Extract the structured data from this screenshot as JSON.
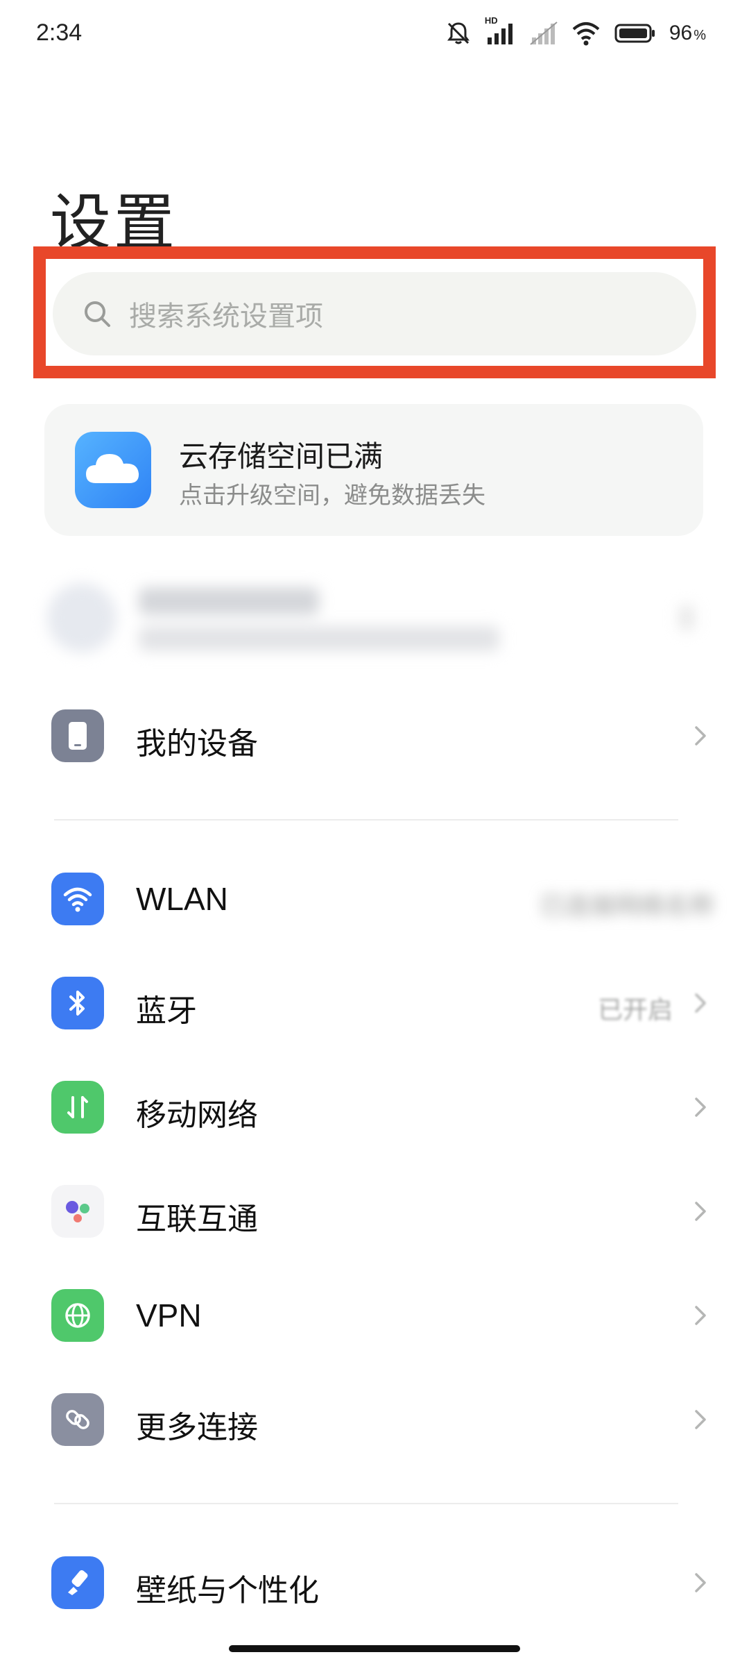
{
  "status_bar": {
    "time": "2:34",
    "network_badge": "HD",
    "battery_percent": "96",
    "battery_unit": "%"
  },
  "page": {
    "title": "设置"
  },
  "search": {
    "placeholder": "搜索系统设置项",
    "highlight_color": "#e8472a"
  },
  "cloud_card": {
    "title": "云存储空间已满",
    "subtitle": "点击升级空间，避免数据丢失",
    "icon": "cloud-icon"
  },
  "settings": {
    "my_device": {
      "label": "我的设备",
      "icon": "device-icon"
    },
    "wlan": {
      "label": "WLAN",
      "value": "已连接网络名称",
      "icon": "wifi-icon"
    },
    "bluetooth": {
      "label": "蓝牙",
      "value": "已开启",
      "icon": "bluetooth-icon"
    },
    "mobile_network": {
      "label": "移动网络",
      "icon": "mobile-network-icon"
    },
    "interconnect": {
      "label": "互联互通",
      "icon": "interconnect-icon"
    },
    "vpn": {
      "label": "VPN",
      "icon": "globe-icon"
    },
    "more_connections": {
      "label": "更多连接",
      "icon": "link-icon"
    },
    "wallpaper": {
      "label": "壁纸与个性化",
      "icon": "brush-icon"
    }
  },
  "colors": {
    "accent_blue": "#3d7bf2",
    "network_green": "#4fc86b",
    "vpn_green": "#4fc86b",
    "device_gray": "#7c8294",
    "link_gray": "#8a8fa0"
  }
}
